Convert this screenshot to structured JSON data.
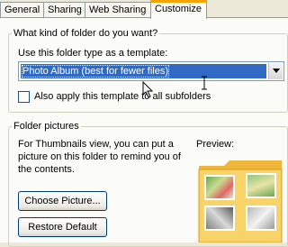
{
  "tabs": [
    "General",
    "Sharing",
    "Web Sharing",
    "Customize"
  ],
  "folder_type": {
    "legend": "What kind of folder do you want?",
    "prompt": "Use this folder type as a template:",
    "selected": "Photo Album (best for fewer files)",
    "apply_label": "Also apply this template to all subfolders"
  },
  "folder_pictures": {
    "legend": "Folder pictures",
    "description_lines": [
      "For Thumbnails view, you can put a",
      "picture on this folder to remind you of",
      "the contents."
    ],
    "preview_label": "Preview:",
    "choose_button": "Choose Picture...",
    "restore_button": "Restore Default"
  },
  "colors": {
    "highlight": "#316ac5",
    "active_tab": "#f7a300",
    "folder": "#f5c542"
  }
}
